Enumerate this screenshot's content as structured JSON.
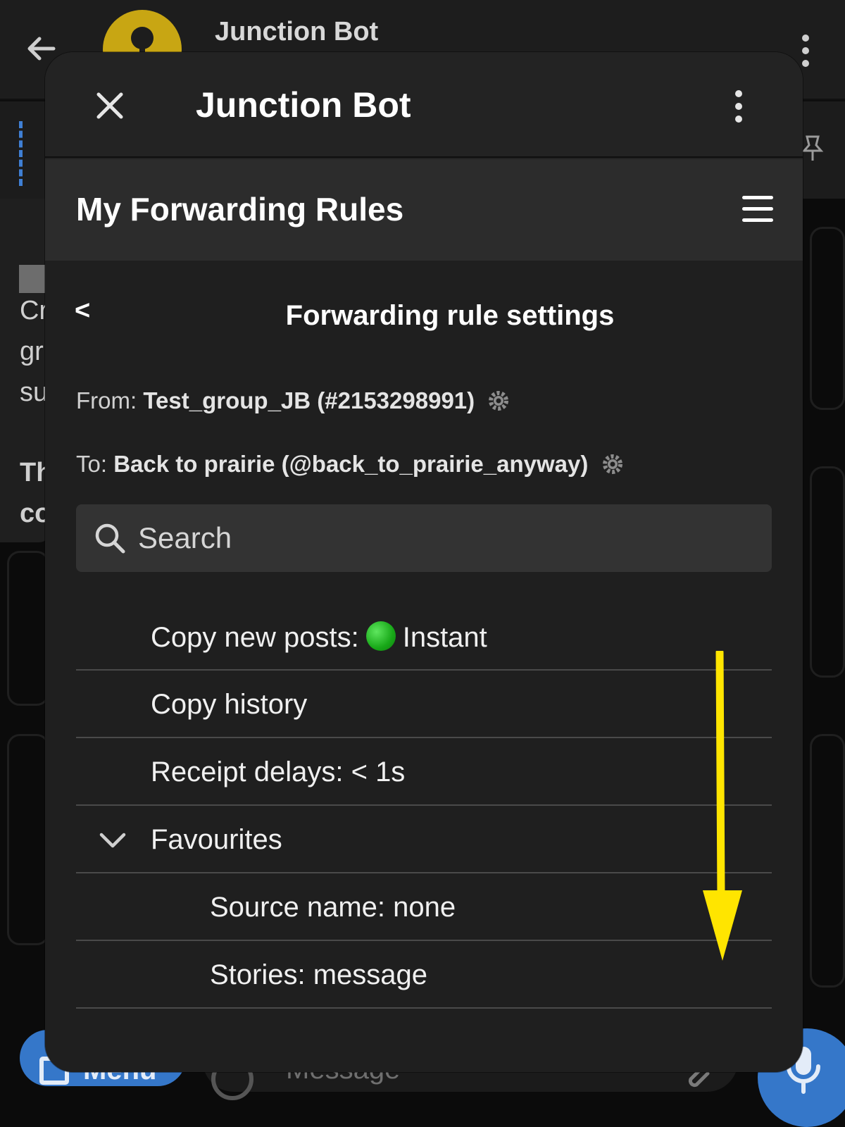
{
  "background": {
    "chat_title": "Junction Bot",
    "message_snippets": [
      "Cr",
      "gr",
      "su",
      "Th",
      "co"
    ],
    "menu_label": "Menu",
    "message_placeholder": "Message"
  },
  "modal": {
    "title": "Junction Bot",
    "app_title": "My Forwarding Rules",
    "back_label": "<",
    "page_title": "Forwarding rule settings",
    "from_label": "From:",
    "from_value": "Test_group_JB (#2153298991)",
    "to_label": "To:",
    "to_value": "Back to prairie (@back_to_prairie_anyway)",
    "search_placeholder": "Search",
    "items": [
      {
        "label_before": "Copy new posts:",
        "status": "Instant",
        "status_color": "#1fb31f"
      },
      {
        "label": "Copy history"
      },
      {
        "label": "Receipt delays: < 1s"
      },
      {
        "label": "Favourites",
        "expanded": true
      },
      {
        "label": "Source name: none"
      },
      {
        "label": "Stories: message"
      }
    ]
  },
  "colors": {
    "accent_blue": "#3577c9",
    "annotation_arrow": "#ffe500",
    "modal_bg": "#232323"
  }
}
